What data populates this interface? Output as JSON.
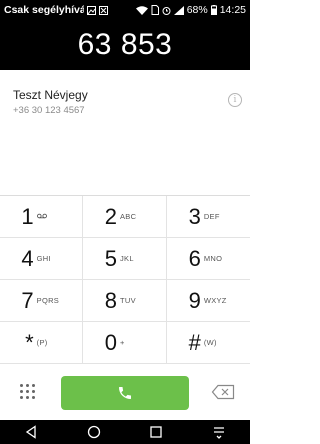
{
  "status_bar": {
    "carrier": "Csak segélyhívá...",
    "battery_percent": "68%",
    "time": "14:25",
    "icons": [
      "image-icon",
      "close-box-icon",
      "wifi-icon",
      "sim-icon",
      "alarm-icon",
      "signal-icon",
      "battery-icon"
    ]
  },
  "dialer": {
    "number": "63 853"
  },
  "suggestion": {
    "name": "Teszt Névjegy",
    "number": "+36 30 123 4567"
  },
  "keypad": [
    {
      "digit": "1",
      "letters": "oo",
      "name": "key-1"
    },
    {
      "digit": "2",
      "letters": "ABC",
      "name": "key-2"
    },
    {
      "digit": "3",
      "letters": "DEF",
      "name": "key-3"
    },
    {
      "digit": "4",
      "letters": "GHI",
      "name": "key-4"
    },
    {
      "digit": "5",
      "letters": "JKL",
      "name": "key-5"
    },
    {
      "digit": "6",
      "letters": "MNO",
      "name": "key-6"
    },
    {
      "digit": "7",
      "letters": "PQRS",
      "name": "key-7"
    },
    {
      "digit": "8",
      "letters": "TUV",
      "name": "key-8"
    },
    {
      "digit": "9",
      "letters": "WXYZ",
      "name": "key-9"
    },
    {
      "digit": "*",
      "letters": "(P)",
      "name": "key-star"
    },
    {
      "digit": "0",
      "letters": "+",
      "name": "key-0"
    },
    {
      "digit": "#",
      "letters": "(W)",
      "name": "key-hash"
    }
  ],
  "colors": {
    "call_green": "#6cc04a",
    "background_dark": "#000000"
  }
}
